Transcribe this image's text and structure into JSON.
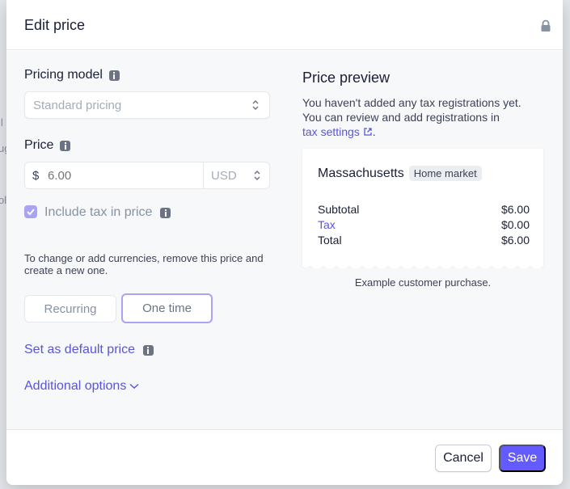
{
  "modal": {
    "title": "Edit price",
    "lock_icon": "lock-icon"
  },
  "left": {
    "pricing_model_label": "Pricing model",
    "pricing_model_value": "Standard pricing",
    "price_label": "Price",
    "currency_symbol": "$",
    "price_placeholder": "6.00",
    "currency_code": "USD",
    "include_tax_label": "Include tax in price",
    "include_tax_checked": true,
    "help_text": "To change or add currencies, remove this price and create a new one.",
    "recurring_label": "Recurring",
    "one_time_label": "One time",
    "selected_type": "One time",
    "default_price_link": "Set as default price",
    "additional_options_link": "Additional options"
  },
  "preview": {
    "title": "Price preview",
    "desc_line1": "You haven't added any tax registrations yet.",
    "desc_line2": "You can review and add registrations in",
    "tax_settings_link": "tax settings",
    "desc_end": ".",
    "region": "Massachusetts",
    "region_badge": "Home market",
    "rows": [
      {
        "label": "Subtotal",
        "value": "$6.00"
      },
      {
        "label": "Tax",
        "value": "$0.00"
      },
      {
        "label": "Total",
        "value": "$6.00"
      }
    ],
    "caption": "Example customer purchase."
  },
  "footer": {
    "cancel_label": "Cancel",
    "save_label": "Save"
  },
  "background": {
    "ghost_chars": [
      "ll",
      "ug",
      "ol"
    ]
  },
  "colors": {
    "accent": "#635bff",
    "link": "#5a55d8"
  }
}
